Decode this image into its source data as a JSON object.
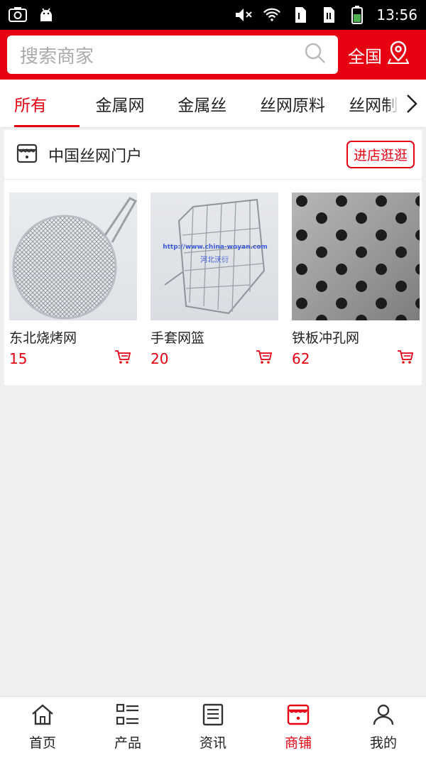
{
  "status_bar": {
    "time": "13:56",
    "icons": [
      "screenshot-icon",
      "android-icon",
      "mute-icon",
      "wifi-icon",
      "sim1-icon",
      "sim2-icon",
      "battery-icon"
    ]
  },
  "header": {
    "search_placeholder": "搜索商家",
    "region_label": "全国",
    "accent_color": "#e60012"
  },
  "tabs": [
    {
      "label": "所有",
      "active": true
    },
    {
      "label": "金属网",
      "active": false
    },
    {
      "label": "金属丝",
      "active": false
    },
    {
      "label": "丝网原料",
      "active": false
    },
    {
      "label": "丝网制品",
      "active": false
    }
  ],
  "store": {
    "name": "中国丝网门户",
    "visit_label": "进店逛逛",
    "products": [
      {
        "name": "东北烧烤网",
        "price": "15"
      },
      {
        "name": "手套网篮",
        "price": "20",
        "image_text": "http://www.china-woyan.com",
        "image_subtext": "河北沃衍"
      },
      {
        "name": "铁板冲孔网",
        "price": "62"
      }
    ]
  },
  "bottom_nav": [
    {
      "label": "首页",
      "icon": "home-icon",
      "active": false
    },
    {
      "label": "产品",
      "icon": "product-list-icon",
      "active": false
    },
    {
      "label": "资讯",
      "icon": "news-icon",
      "active": false
    },
    {
      "label": "商铺",
      "icon": "shop-icon",
      "active": true
    },
    {
      "label": "我的",
      "icon": "user-icon",
      "active": false
    }
  ]
}
